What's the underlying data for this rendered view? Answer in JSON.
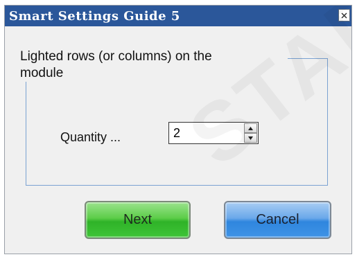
{
  "window": {
    "title": "Smart Settings Guide 5",
    "close_icon": "close-icon"
  },
  "group": {
    "legend_line1": "Lighted rows (or columns) on the",
    "legend_line2": "module"
  },
  "quantity": {
    "label": "Quantity ...",
    "value": "2"
  },
  "buttons": {
    "next": "Next",
    "cancel": "Cancel"
  },
  "watermark": "STAR T",
  "colors": {
    "title_bar": "#2b579a",
    "next_button": "#3fc437",
    "cancel_button": "#3f93e6",
    "group_border": "#7aa1d2"
  }
}
